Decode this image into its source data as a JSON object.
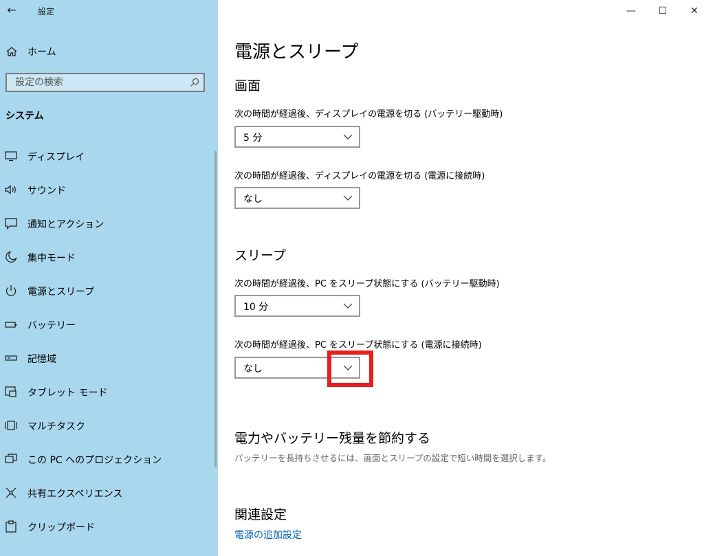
{
  "window": {
    "title": "設定",
    "back_icon": "back-arrow-icon",
    "minimize_glyph": "—",
    "maximize_glyph": "☐",
    "close_glyph": "✕"
  },
  "sidebar": {
    "home_label": "ホーム",
    "search_placeholder": "設定の検索",
    "section_title": "システム",
    "items": [
      {
        "label": "ディスプレイ",
        "icon": "display-icon"
      },
      {
        "label": "サウンド",
        "icon": "speaker-icon"
      },
      {
        "label": "通知とアクション",
        "icon": "notification-icon"
      },
      {
        "label": "集中モード",
        "icon": "moon-icon"
      },
      {
        "label": "電源とスリープ",
        "icon": "power-icon"
      },
      {
        "label": "バッテリー",
        "icon": "battery-icon"
      },
      {
        "label": "記憶域",
        "icon": "storage-icon"
      },
      {
        "label": "タブレット モード",
        "icon": "tablet-icon"
      },
      {
        "label": "マルチタスク",
        "icon": "multitask-icon"
      },
      {
        "label": "この PC へのプロジェクション",
        "icon": "projection-icon"
      },
      {
        "label": "共有エクスペリエンス",
        "icon": "share-icon"
      },
      {
        "label": "クリップボード",
        "icon": "clipboard-icon"
      }
    ]
  },
  "main": {
    "title": "電源とスリープ",
    "screen": {
      "heading": "画面",
      "battery_label": "次の時間が経過後、ディスプレイの電源を切る (バッテリー駆動時)",
      "battery_value": "5 分",
      "plugged_label": "次の時間が経過後、ディスプレイの電源を切る (電源に接続時)",
      "plugged_value": "なし"
    },
    "sleep": {
      "heading": "スリープ",
      "battery_label": "次の時間が経過後、PC をスリープ状態にする (バッテリー駆動時)",
      "battery_value": "10 分",
      "plugged_label": "次の時間が経過後、PC をスリープ状態にする (電源に接続時)",
      "plugged_value": "なし"
    },
    "save": {
      "heading": "電力やバッテリー残量を節約する",
      "description": "バッテリーを長持ちさせるには、画面とスリープの設定で短い時間を選択します。"
    },
    "related": {
      "heading": "関連設定",
      "link": "電源の追加設定"
    }
  },
  "colors": {
    "sidebar_bg": "#a9d7ee",
    "highlight": "#e61e1e",
    "link": "#0067b8"
  }
}
